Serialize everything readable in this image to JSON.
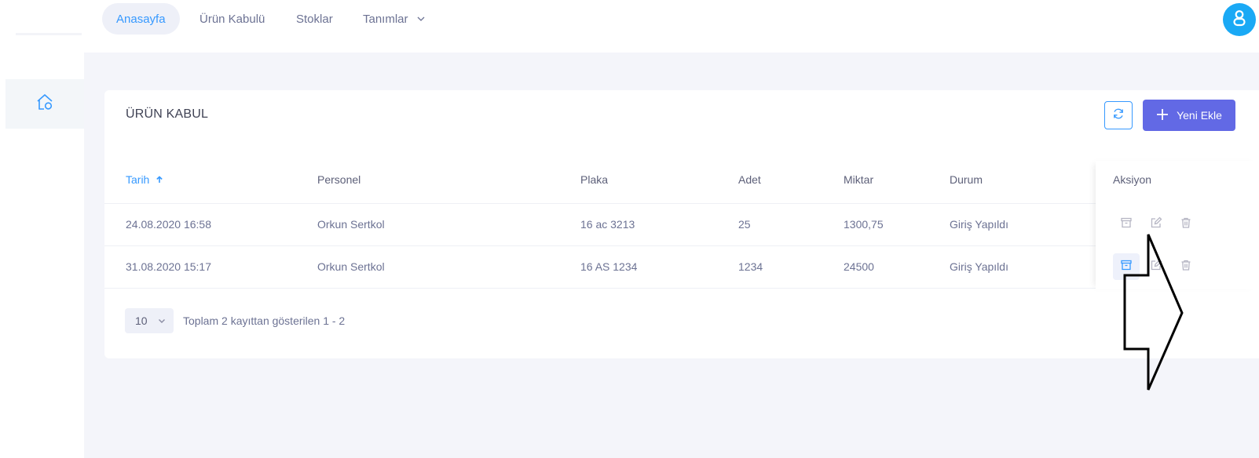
{
  "nav": {
    "items": [
      {
        "label": "Anasayfa",
        "active": true
      },
      {
        "label": "Ürün Kabulü",
        "active": false
      },
      {
        "label": "Stoklar",
        "active": false
      },
      {
        "label": "Tanımlar",
        "active": false,
        "has_dropdown": true
      }
    ]
  },
  "card": {
    "title": "ÜRÜN KABUL",
    "new_button_label": "Yeni Ekle"
  },
  "table": {
    "columns": [
      "Tarih",
      "Personel",
      "Plaka",
      "Adet",
      "Miktar",
      "Durum",
      "Aksiyon"
    ],
    "sorted_column": "Tarih",
    "rows": [
      {
        "tarih": "24.08.2020 16:58",
        "personel": "Orkun Sertkol",
        "plaka": "16 ac 3213",
        "adet": "25",
        "miktar": "1300,75",
        "durum": "Giriş Yapıldı"
      },
      {
        "tarih": "31.08.2020 15:17",
        "personel": "Orkun Sertkol",
        "plaka": "16 AS 1234",
        "adet": "1234",
        "miktar": "24500",
        "durum": "Giriş Yapıldı"
      }
    ]
  },
  "pager": {
    "page_size": "10",
    "info": "Toplam 2 kayıttan gösterilen 1 - 2"
  },
  "icons": {
    "home": "home-icon",
    "user": "user-icon",
    "refresh": "refresh-icon",
    "plus": "plus-icon",
    "archive": "archive-icon",
    "edit": "edit-icon",
    "delete": "trash-icon",
    "chevron": "chevron-down-icon",
    "sort": "arrow-up-icon"
  },
  "colors": {
    "primary": "#3699ff",
    "button": "#6269e5",
    "avatar": "#1aa9f5"
  }
}
